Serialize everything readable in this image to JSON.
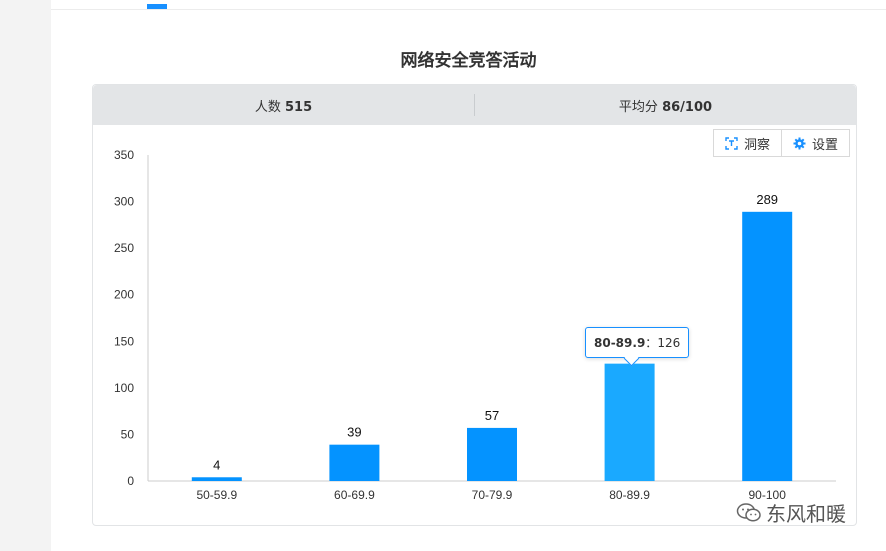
{
  "page": {
    "title": "网络安全竞答活动"
  },
  "stats": {
    "participants_label": "人数",
    "participants_value": "515",
    "average_label": "平均分",
    "average_value": "86/100"
  },
  "toolbar": {
    "insight_label": "洞察",
    "settings_label": "设置"
  },
  "tooltip": {
    "category": "80-89.9",
    "separator": "：",
    "value": "126"
  },
  "watermark": {
    "text": "东风和暖"
  },
  "colors": {
    "bar": "#0493ff",
    "bar_highlight": "#1aa9ff",
    "accent": "#1890ff"
  },
  "chart_data": {
    "type": "bar",
    "categories": [
      "50-59.9",
      "60-69.9",
      "70-79.9",
      "80-89.9",
      "90-100"
    ],
    "values": [
      4,
      39,
      57,
      126,
      289
    ],
    "title": "",
    "xlabel": "",
    "ylabel": "",
    "ylim": [
      0,
      350
    ],
    "yticks": [
      0,
      50,
      100,
      150,
      200,
      250,
      300,
      350
    ],
    "data_labels": [
      "4",
      "39",
      "57",
      "126",
      "289"
    ],
    "highlighted_category": "80-89.9",
    "grid": false,
    "legend": "none"
  }
}
